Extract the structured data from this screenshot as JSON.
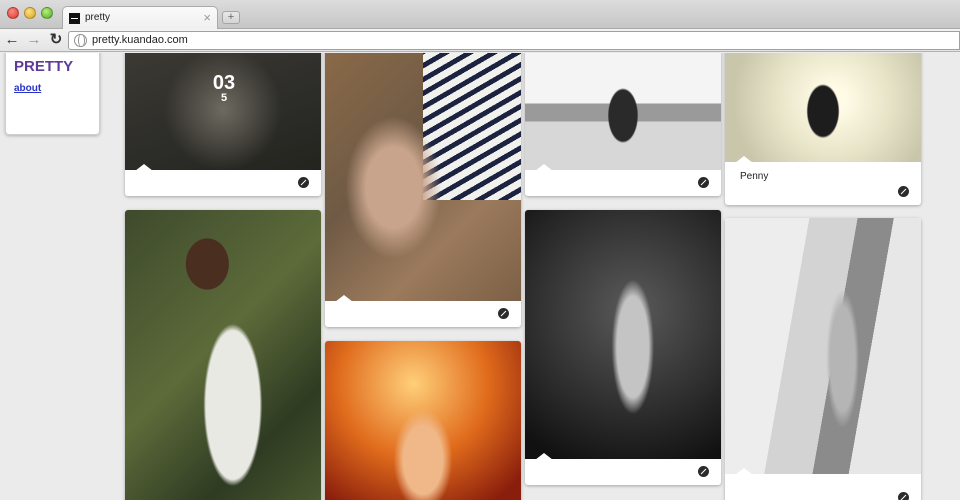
{
  "browser": {
    "tab_title": "pretty",
    "tab_close": "×",
    "new_tab": "+",
    "url": "pretty.kuandao.com",
    "back": "←",
    "forward": "→",
    "reload": "↻"
  },
  "site": {
    "title": "PRETTY",
    "about": "about"
  },
  "cards": [
    {
      "photo": "forest-girl-photo",
      "date_day": "03",
      "date_month": "5",
      "caption": ""
    },
    {
      "photo": "striped-shirt-photo",
      "caption": ""
    },
    {
      "photo": "beach-bikini-photo",
      "caption": ""
    },
    {
      "photo": "black-corset-photo",
      "caption": "Penny"
    },
    {
      "photo": "woods-white-dress-photo",
      "caption": ""
    },
    {
      "photo": "orange-light-photo",
      "caption": ""
    },
    {
      "photo": "bw-lingerie-photo",
      "caption": ""
    },
    {
      "photo": "bw-window-pose-photo",
      "caption": ""
    }
  ],
  "colors": {
    "title": "#5e3b98",
    "link": "#2a33c8",
    "page_bg": "#ebebeb"
  },
  "icons": {
    "card_action": "pin-icon",
    "address": "globe-icon"
  }
}
